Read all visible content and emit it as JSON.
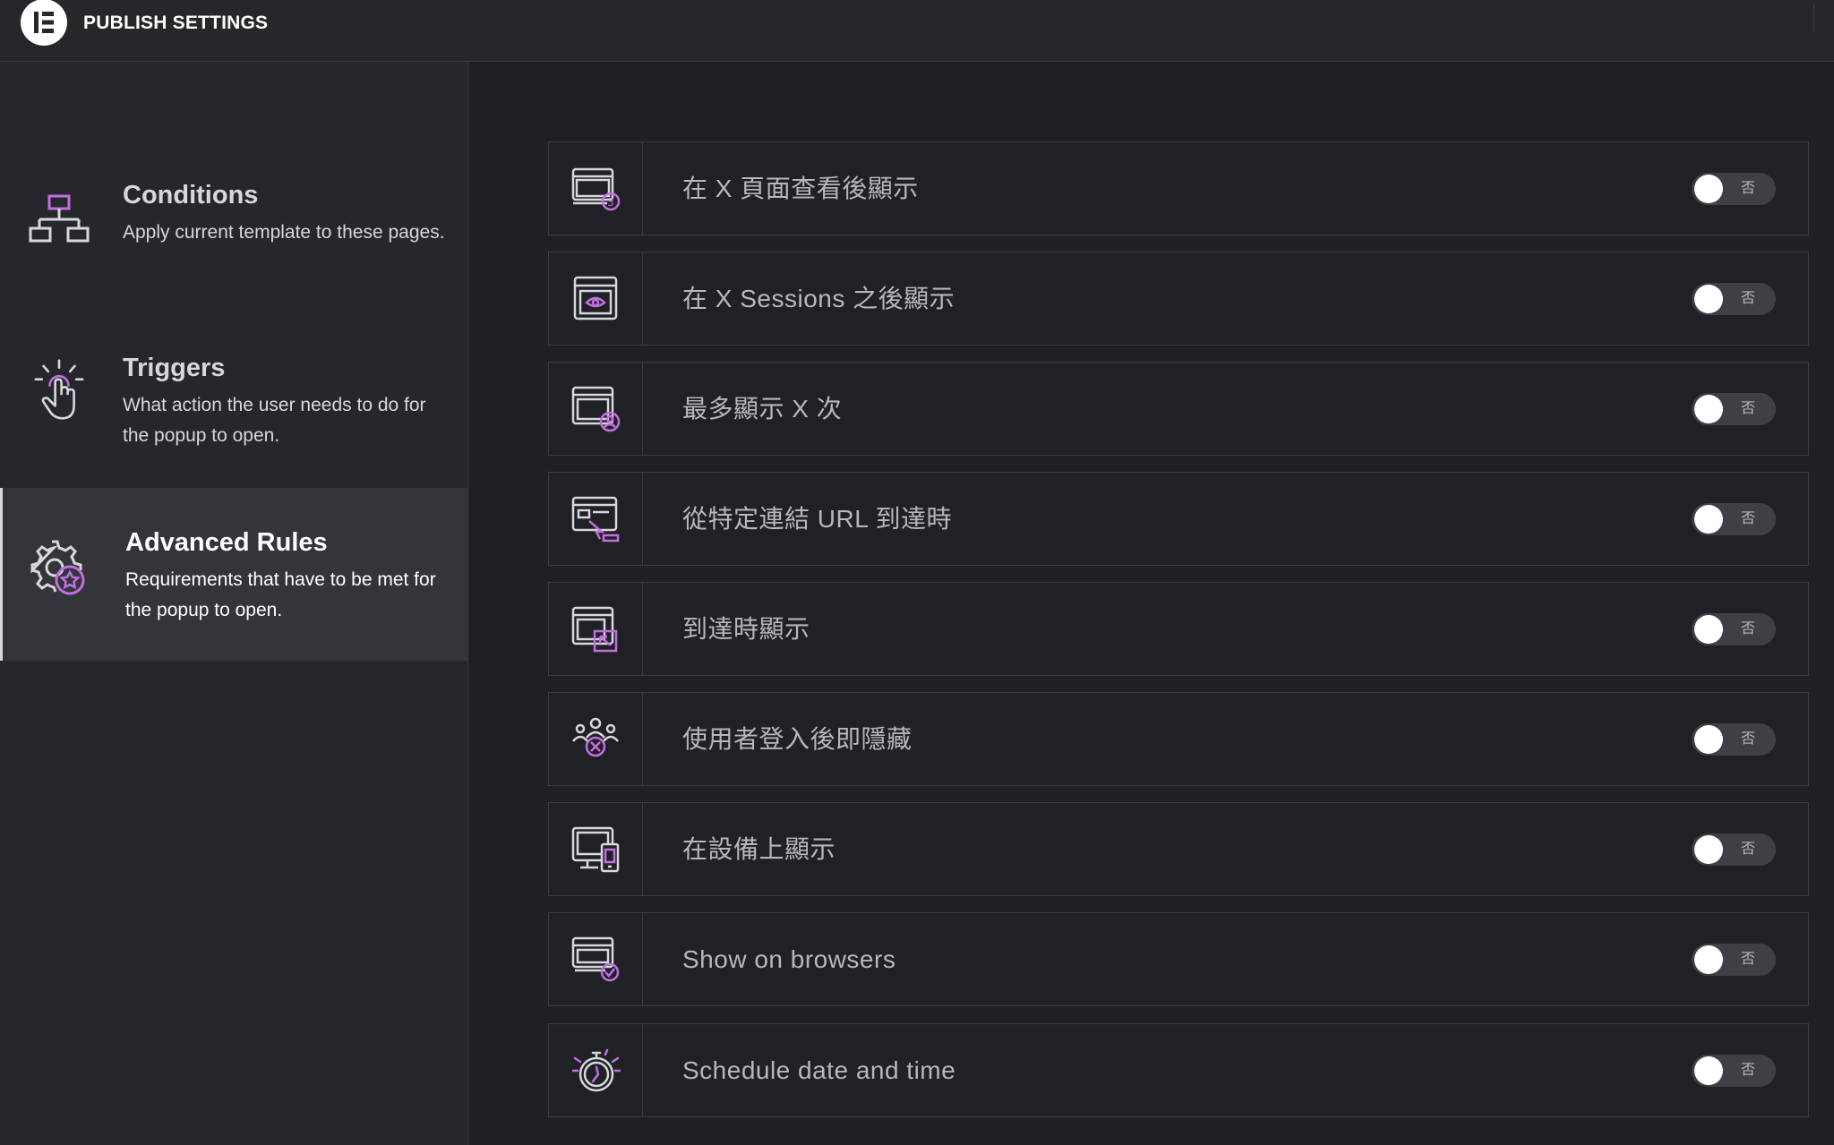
{
  "header": {
    "title": "PUBLISH SETTINGS",
    "logo_icon": "elementor-logo-icon"
  },
  "sidebar": {
    "items": [
      {
        "title": "Conditions",
        "description": "Apply current template to these pages.",
        "icon": "sitemap-icon",
        "active": false
      },
      {
        "title": "Triggers",
        "description": "What action the user needs to do for the popup to open.",
        "icon": "pointer-click-icon",
        "active": false
      },
      {
        "title": "Advanced Rules",
        "description": "Requirements that have to be met for the popup to open.",
        "icon": "gear-star-icon",
        "active": true
      }
    ]
  },
  "rules": [
    {
      "label": "在 X 頁面查看後顯示",
      "icon": "page-views-icon",
      "toggle": "否",
      "enabled": false
    },
    {
      "label": "在 X Sessions 之後顯示",
      "icon": "sessions-eye-icon",
      "toggle": "否",
      "enabled": false
    },
    {
      "label": "最多顯示 X 次",
      "icon": "max-times-user-icon",
      "toggle": "否",
      "enabled": false
    },
    {
      "label": "從特定連結 URL 到達時",
      "icon": "url-link-cursor-icon",
      "toggle": "否",
      "enabled": false
    },
    {
      "label": "到達時顯示",
      "icon": "arrival-arrow-icon",
      "toggle": "否",
      "enabled": false
    },
    {
      "label": "使用者登入後即隱藏",
      "icon": "users-hide-icon",
      "toggle": "否",
      "enabled": false
    },
    {
      "label": "在設備上顯示",
      "icon": "devices-icon",
      "toggle": "否",
      "enabled": false
    },
    {
      "label": "Show on browsers",
      "icon": "browser-check-icon",
      "toggle": "否",
      "enabled": false
    },
    {
      "label": "Schedule date and time",
      "icon": "stopwatch-icon",
      "toggle": "否",
      "enabled": false
    }
  ],
  "colors": {
    "accent": "#c36ee0",
    "icon_stroke": "#d5d8dc"
  }
}
